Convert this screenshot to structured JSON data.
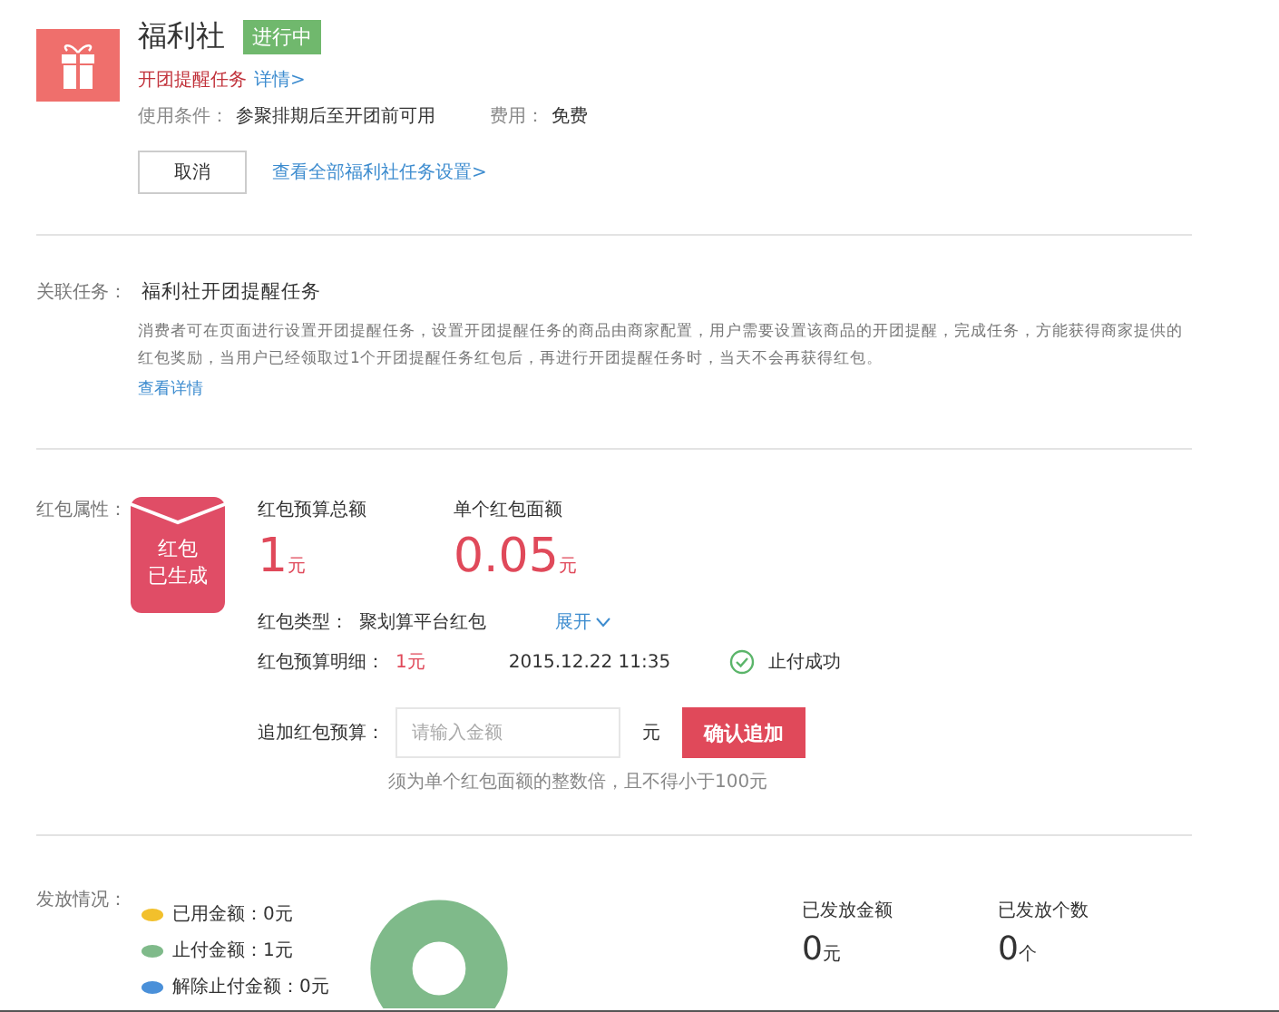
{
  "header": {
    "title": "福利社",
    "status": "进行中",
    "task": "开团提醒任务",
    "details_link": "详情>",
    "condition_label": "使用条件：",
    "condition_value": "参聚排期后至开团前可用",
    "fee_label": "费用：",
    "fee_value": "免费",
    "cancel_button": "取消",
    "settings_link": "查看全部福利社任务设置>"
  },
  "related": {
    "label": "关联任务：",
    "title": "福利社开团提醒任务",
    "description": "消费者可在页面进行设置开团提醒任务，设置开团提醒任务的商品由商家配置，用户需要设置该商品的开团提醒，完成任务，方能获得商家提供的红包奖励，当用户已经领取过1个开团提醒任务红包后，再进行开团提醒任务时，当天不会再获得红包。",
    "more_link": "查看详情"
  },
  "packet": {
    "label": "红包属性：",
    "badge_line1": "红包",
    "badge_line2": "已生成",
    "total_label": "红包预算总额",
    "total_value": "1",
    "total_unit": "元",
    "single_label": "单个红包面额",
    "single_value": "0.05",
    "single_unit": "元",
    "type_label": "红包类型：",
    "type_value": "聚划算平台红包",
    "expand_link": "展开",
    "detail_label": "红包预算明细：",
    "detail_value": "1元",
    "detail_time": "2015.12.22 11:35",
    "detail_status": "止付成功",
    "add_label": "追加红包预算：",
    "add_placeholder": "请输入金额",
    "add_unit": "元",
    "add_button": "确认追加",
    "add_hint": "须为单个红包面额的整数倍，且不得小于100元"
  },
  "distribution": {
    "label": "发放情况：",
    "legend": [
      {
        "text": "已用金额：0元",
        "color": "#f2c02c"
      },
      {
        "text": "止付金额：1元",
        "color": "#7fba8a"
      },
      {
        "text": "解除止付金额：0元",
        "color": "#4a90d9"
      }
    ],
    "chart_data": {
      "type": "donut",
      "values": [
        0,
        1,
        0
      ]
    },
    "stats": [
      {
        "label": "已发放金额",
        "value": "0",
        "unit": "元"
      },
      {
        "label": "已发放个数",
        "value": "0",
        "unit": "个"
      }
    ]
  }
}
